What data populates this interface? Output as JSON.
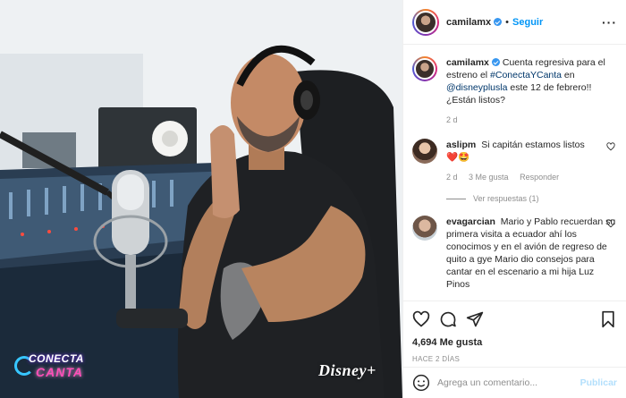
{
  "post": {
    "username": "camilamx",
    "follow_label": "Seguir",
    "separator": "•",
    "more_label": "···"
  },
  "caption": {
    "username": "camilamx",
    "text_1": "Cuenta regresiva para el estreno el ",
    "hashtag": "#ConectaYCanta",
    "text_2": " en ",
    "mention": "@disneyplusla",
    "text_3": " este 12 de febrero!! ¿Están listos?",
    "age": "2 d"
  },
  "comments": [
    {
      "username": "aslipm",
      "text": "Si capitán estamos listos",
      "emoji": "❤️🤩",
      "age": "2 d",
      "likes": "3 Me gusta",
      "reply_label": "Responder",
      "view_replies": "Ver respuestas (1)"
    },
    {
      "username": "evagarcian",
      "text": "Mario y Pablo recuerdan su primera visita a ecuador ahí los conocimos y en el avión de regreso de quito a gye Mario dio consejos para cantar en el escenario a mi hija Luz Pinos"
    }
  ],
  "actions": {
    "likes": "4,694 Me gusta",
    "time_ago": "HACE 2 DÍAS"
  },
  "add_comment": {
    "placeholder": "Agrega un comentario...",
    "post_label": "Publicar"
  },
  "overlay": {
    "conecta_line1": "CONECTA",
    "conecta_line2": "CANTA",
    "disney": "Disney+"
  },
  "colors": {
    "link": "#00376b",
    "follow": "#0095f6",
    "verified": "#3897f0",
    "muted": "#8e8e8e",
    "post_disabled": "#b2dffc"
  },
  "icons": [
    "heart-icon",
    "comment-icon",
    "share-icon",
    "bookmark-icon",
    "emoji-icon",
    "verified-icon",
    "more-icon"
  ]
}
